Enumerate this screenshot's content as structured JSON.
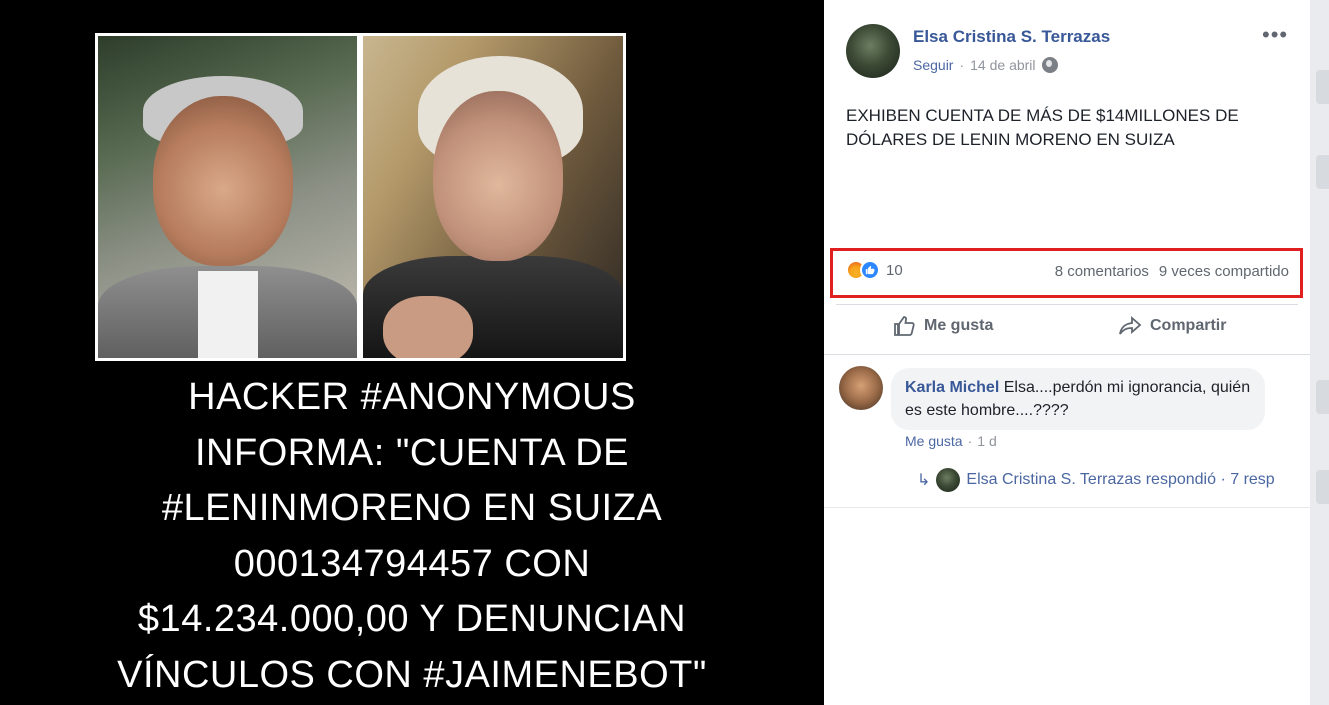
{
  "media": {
    "headline_lines": [
      "HACKER #ANONYMOUS",
      "INFORMA: \"CUENTA DE",
      "#LENINMORENO EN SUIZA",
      "000134794457 CON",
      "$14.234.000,00 Y DENUNCIAN",
      "VÍNCULOS CON #JAIMENEBOT\""
    ]
  },
  "post": {
    "author": "Elsa Cristina S. Terrazas",
    "follow": "Seguir",
    "separator": "·",
    "date": "14 de abril",
    "privacy_icon": "globe-icon",
    "more_icon": "•••",
    "text": "EXHIBEN CUENTA DE MÁS DE $14MILLONES DE DÓLARES DE LENIN MORENO EN SUIZA",
    "reaction_count": "10",
    "comments_count": "8 comentarios",
    "shares_count": "9 veces compartido",
    "highlight_color": "#e02020",
    "actions": {
      "like": "Me gusta",
      "share": "Compartir"
    }
  },
  "comment": {
    "author": "Karla Michel",
    "text": "Elsa....perdón mi ignorancia, quién es este hombre....????",
    "like": "Me gusta",
    "separator": "·",
    "age": "1 d",
    "reply_text": "Elsa Cristina S. Terrazas respondió · 7 resp"
  },
  "colors": {
    "link_blue": "#385898",
    "muted": "#90949c"
  }
}
